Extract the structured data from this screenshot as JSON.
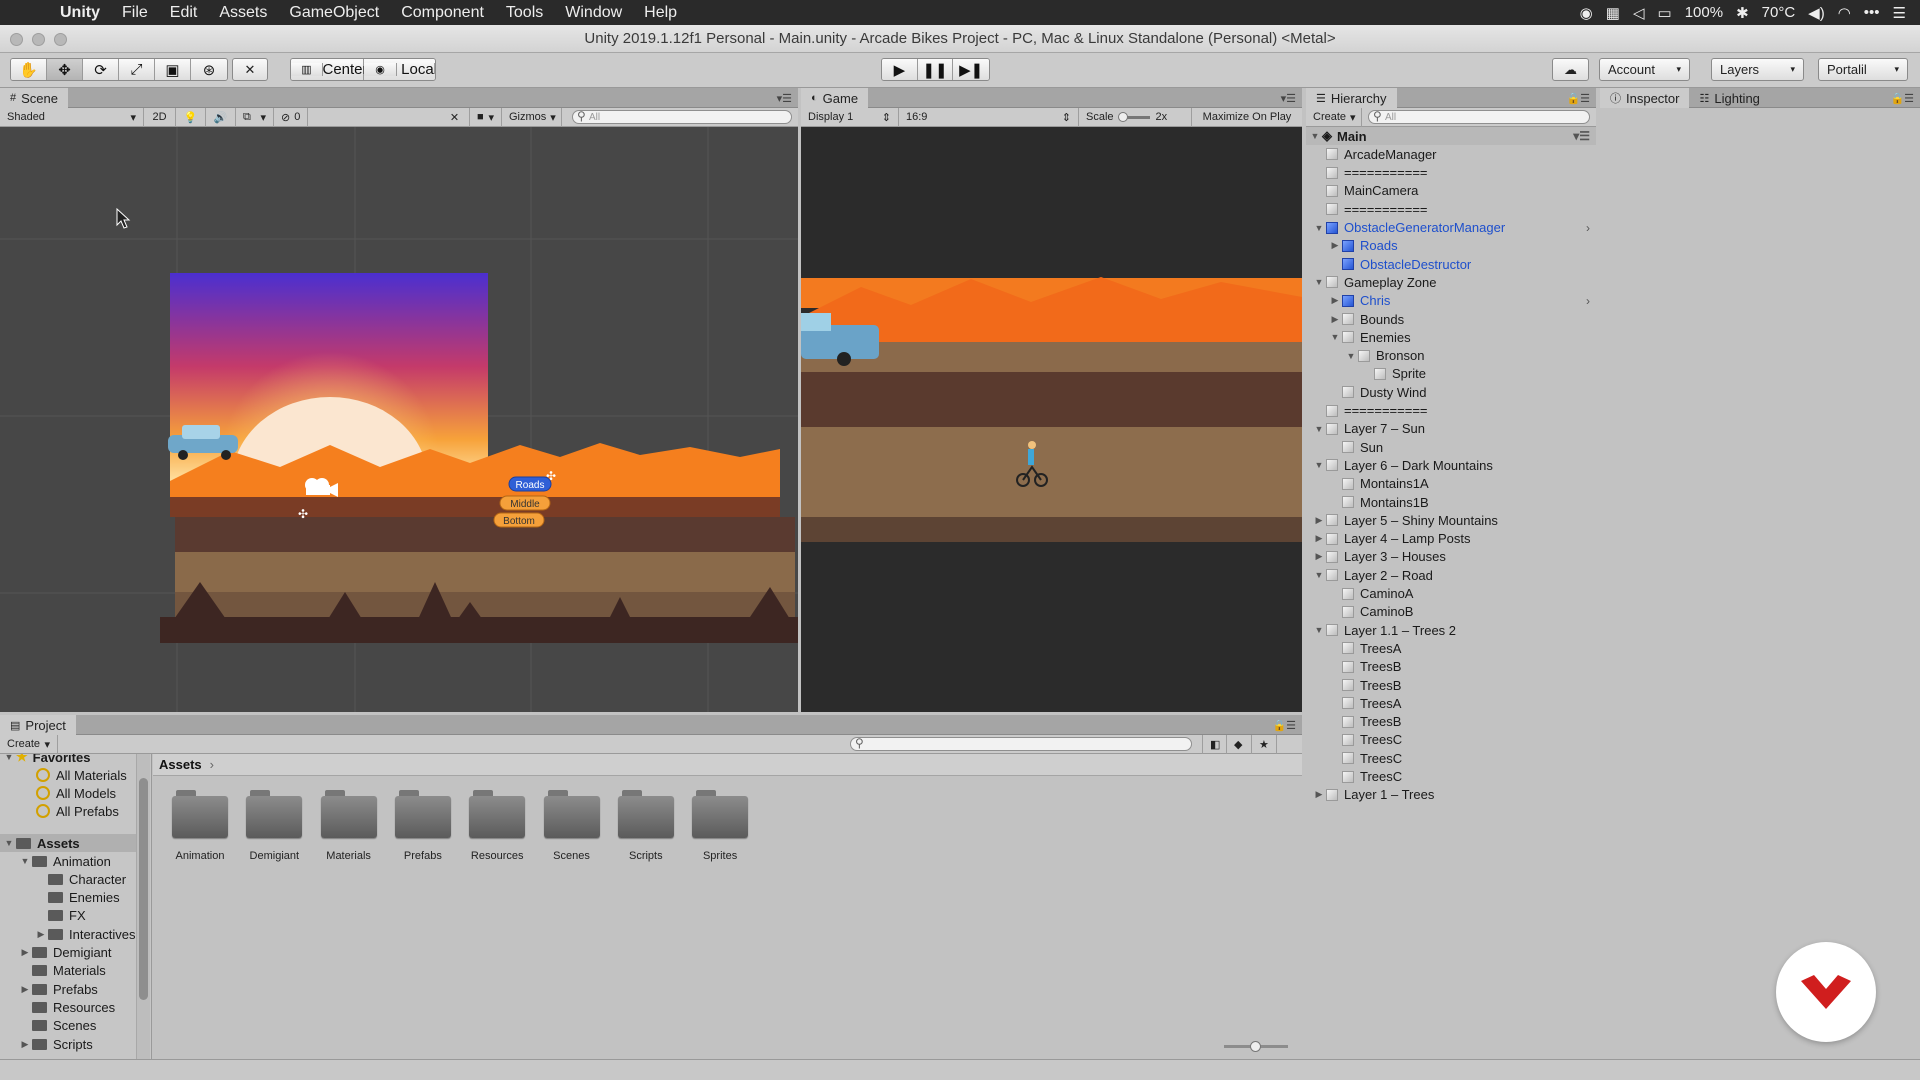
{
  "menubar": {
    "app": "Unity",
    "items": [
      "File",
      "Edit",
      "Assets",
      "GameObject",
      "Component",
      "Tools",
      "Window",
      "Help"
    ],
    "battery": "100%",
    "temperature": "70°C"
  },
  "window": {
    "title": "Unity 2019.1.12f1 Personal - Main.unity - Arcade Bikes Project - PC, Mac & Linux Standalone (Personal) <Metal>"
  },
  "toolbar": {
    "pivot": "Center",
    "space": "Local",
    "account": "Account",
    "layers": "Layers",
    "layout": "Portalil"
  },
  "scene": {
    "tab": "Scene",
    "shading": "Shaded",
    "mode_2d": "2D",
    "fx_count": "0",
    "gizmos": "Gizmos",
    "search_placeholder": "All",
    "labels": {
      "roads": "Roads",
      "middle": "Middle",
      "bottom": "Bottom"
    }
  },
  "game": {
    "tab": "Game",
    "display": "Display 1",
    "aspect": "16:9",
    "scale_label": "Scale",
    "scale_value": "2x",
    "maximize": "Maximize On Play"
  },
  "hierarchy": {
    "tab": "Hierarchy",
    "create": "Create",
    "search_placeholder": "All",
    "scene": "Main",
    "rows": [
      {
        "label": "ArcadeManager",
        "depth": 1,
        "arrow": "",
        "blue": false
      },
      {
        "label": "===========",
        "depth": 1,
        "arrow": "",
        "blue": false
      },
      {
        "label": "MainCamera",
        "depth": 1,
        "arrow": "",
        "blue": false
      },
      {
        "label": "===========",
        "depth": 1,
        "arrow": "",
        "blue": false
      },
      {
        "label": "ObstacleGeneratorManager",
        "depth": 1,
        "arrow": "open",
        "blue": true,
        "chevron": true
      },
      {
        "label": "Roads",
        "depth": 2,
        "arrow": "closed",
        "blue": true
      },
      {
        "label": "ObstacleDestructor",
        "depth": 2,
        "arrow": "",
        "blue": true
      },
      {
        "label": "Gameplay Zone",
        "depth": 1,
        "arrow": "open",
        "blue": false
      },
      {
        "label": "Chris",
        "depth": 2,
        "arrow": "closed",
        "blue": true,
        "chevron": true
      },
      {
        "label": "Bounds",
        "depth": 2,
        "arrow": "closed",
        "blue": false
      },
      {
        "label": "Enemies",
        "depth": 2,
        "arrow": "open",
        "blue": false
      },
      {
        "label": "Bronson",
        "depth": 3,
        "arrow": "open",
        "blue": false
      },
      {
        "label": "Sprite",
        "depth": 4,
        "arrow": "",
        "blue": false
      },
      {
        "label": "Dusty Wind",
        "depth": 2,
        "arrow": "",
        "blue": false
      },
      {
        "label": "===========",
        "depth": 1,
        "arrow": "",
        "blue": false
      },
      {
        "label": "Layer 7 – Sun",
        "depth": 1,
        "arrow": "open",
        "blue": false
      },
      {
        "label": "Sun",
        "depth": 2,
        "arrow": "",
        "blue": false
      },
      {
        "label": "Layer 6 – Dark Mountains",
        "depth": 1,
        "arrow": "open",
        "blue": false
      },
      {
        "label": "Montains1A",
        "depth": 2,
        "arrow": "",
        "blue": false
      },
      {
        "label": "Montains1B",
        "depth": 2,
        "arrow": "",
        "blue": false
      },
      {
        "label": "Layer 5 – Shiny Mountains",
        "depth": 1,
        "arrow": "closed",
        "blue": false
      },
      {
        "label": "Layer 4 – Lamp Posts",
        "depth": 1,
        "arrow": "closed",
        "blue": false
      },
      {
        "label": "Layer 3 – Houses",
        "depth": 1,
        "arrow": "closed",
        "blue": false
      },
      {
        "label": "Layer 2 – Road",
        "depth": 1,
        "arrow": "open",
        "blue": false
      },
      {
        "label": "CaminoA",
        "depth": 2,
        "arrow": "",
        "blue": false
      },
      {
        "label": "CaminoB",
        "depth": 2,
        "arrow": "",
        "blue": false
      },
      {
        "label": "Layer 1.1 – Trees 2",
        "depth": 1,
        "arrow": "open",
        "blue": false
      },
      {
        "label": "TreesA",
        "depth": 2,
        "arrow": "",
        "blue": false
      },
      {
        "label": "TreesB",
        "depth": 2,
        "arrow": "",
        "blue": false
      },
      {
        "label": "TreesB",
        "depth": 2,
        "arrow": "",
        "blue": false
      },
      {
        "label": "TreesA",
        "depth": 2,
        "arrow": "",
        "blue": false
      },
      {
        "label": "TreesB",
        "depth": 2,
        "arrow": "",
        "blue": false
      },
      {
        "label": "TreesC",
        "depth": 2,
        "arrow": "",
        "blue": false
      },
      {
        "label": "TreesC",
        "depth": 2,
        "arrow": "",
        "blue": false
      },
      {
        "label": "TreesC",
        "depth": 2,
        "arrow": "",
        "blue": false
      },
      {
        "label": "Layer 1 – Trees",
        "depth": 1,
        "arrow": "closed",
        "blue": false
      }
    ]
  },
  "inspector": {
    "tab": "Inspector",
    "lighting_tab": "Lighting"
  },
  "project": {
    "tab": "Project",
    "create": "Create",
    "breadcrumb": "Assets",
    "favorites": {
      "label": "Favorites",
      "items": [
        "All Materials",
        "All Models",
        "All Prefabs"
      ]
    },
    "assets_root": "Assets",
    "tree": [
      {
        "label": "Animation",
        "depth": 1,
        "arrow": "open"
      },
      {
        "label": "Character",
        "depth": 2,
        "arrow": ""
      },
      {
        "label": "Enemies",
        "depth": 2,
        "arrow": ""
      },
      {
        "label": "FX",
        "depth": 2,
        "arrow": ""
      },
      {
        "label": "Interactives",
        "depth": 2,
        "arrow": "closed"
      },
      {
        "label": "Demigiant",
        "depth": 1,
        "arrow": "closed"
      },
      {
        "label": "Materials",
        "depth": 1,
        "arrow": ""
      },
      {
        "label": "Prefabs",
        "depth": 1,
        "arrow": "closed"
      },
      {
        "label": "Resources",
        "depth": 1,
        "arrow": ""
      },
      {
        "label": "Scenes",
        "depth": 1,
        "arrow": ""
      },
      {
        "label": "Scripts",
        "depth": 1,
        "arrow": "closed"
      }
    ],
    "folders": [
      "Animation",
      "Demigiant",
      "Materials",
      "Prefabs",
      "Resources",
      "Scenes",
      "Scripts",
      "Sprites"
    ]
  }
}
